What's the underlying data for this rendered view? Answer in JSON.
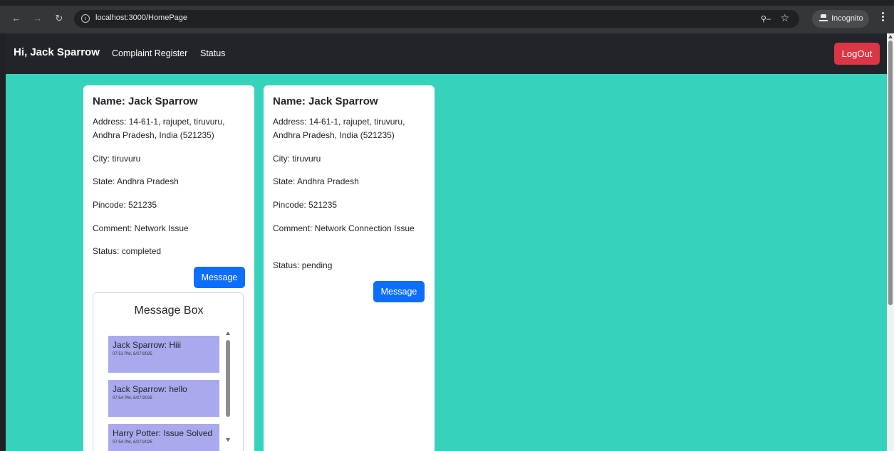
{
  "browser": {
    "url": "localhost:3000/HomePage",
    "incognito_label": "Incognito",
    "icons": [
      "back-icon",
      "forward-icon",
      "reload-icon",
      "site-info-icon",
      "key-icon",
      "star-icon",
      "incognito-icon",
      "menu-icon"
    ]
  },
  "navbar": {
    "greeting": "Hi, Jack Sparrow",
    "links": [
      "Complaint Register",
      "Status"
    ],
    "logout_label": "LogOut",
    "logout_color": "#dc3545",
    "background": "#212529"
  },
  "page": {
    "background": "#37d2bc"
  },
  "complaints": [
    {
      "name": "Name: Jack Sparrow",
      "address": "Address: 14-61-1, rajupet, tiruvuru, Andhra Pradesh, India (521235)",
      "city": "City: tiruvuru",
      "state": "State: Andhra Pradesh",
      "pincode": "Pincode: 521235",
      "comment": "Comment: Network Issue",
      "status": "Status: completed",
      "message_button": "Message",
      "message_box": {
        "title": "Message Box",
        "messages": [
          {
            "text": "Jack Sparrow: Hiii",
            "time": "07:51 PM, 6/27/2025"
          },
          {
            "text": "Jack Sparrow: hello",
            "time": "07:54 PM, 6/27/2025"
          },
          {
            "text": "Harry Potter: Issue Solved",
            "time": "07:54 PM, 6/27/2025"
          }
        ]
      }
    },
    {
      "name": "Name: Jack Sparrow",
      "address": "Address: 14-61-1, rajupet, tiruvuru, Andhra Pradesh, India (521235)",
      "city": "City: tiruvuru",
      "state": "State: Andhra Pradesh",
      "pincode": "Pincode: 521235",
      "comment": "Comment: Network Connection Issue",
      "status": "Status: pending",
      "message_button": "Message"
    }
  ],
  "colors": {
    "primary_button": "#0d6efd",
    "message_bg": "#a9aaee"
  }
}
